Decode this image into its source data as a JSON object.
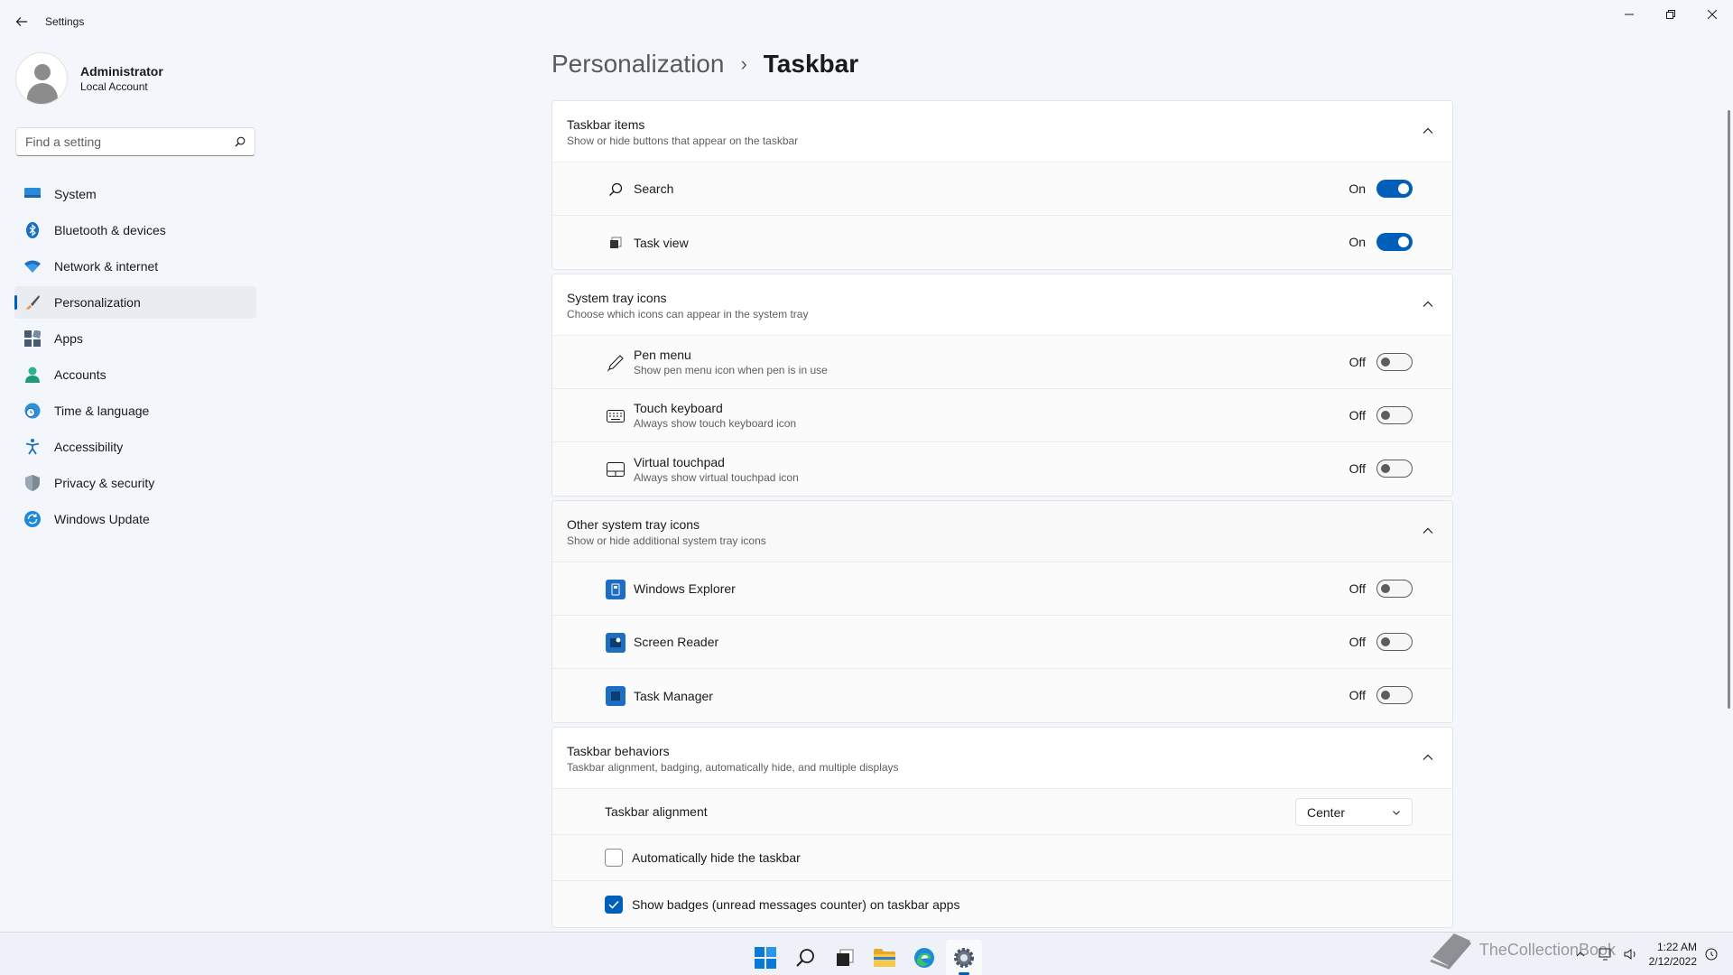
{
  "window": {
    "title": "Settings",
    "controls": [
      "minimize",
      "restore",
      "close"
    ]
  },
  "profile": {
    "name": "Administrator",
    "account_type": "Local Account"
  },
  "search": {
    "placeholder": "Find a setting"
  },
  "nav": [
    {
      "label": "System",
      "icon": "monitor-icon",
      "selected": false
    },
    {
      "label": "Bluetooth & devices",
      "icon": "bluetooth-icon",
      "selected": false
    },
    {
      "label": "Network & internet",
      "icon": "wifi-icon",
      "selected": false
    },
    {
      "label": "Personalization",
      "icon": "brush-icon",
      "selected": true
    },
    {
      "label": "Apps",
      "icon": "apps-icon",
      "selected": false
    },
    {
      "label": "Accounts",
      "icon": "person-icon",
      "selected": false
    },
    {
      "label": "Time & language",
      "icon": "globe-clock-icon",
      "selected": false
    },
    {
      "label": "Accessibility",
      "icon": "accessibility-icon",
      "selected": false
    },
    {
      "label": "Privacy & security",
      "icon": "shield-icon",
      "selected": false
    },
    {
      "label": "Windows Update",
      "icon": "update-icon",
      "selected": false
    }
  ],
  "breadcrumb": {
    "parent": "Personalization",
    "separator": "›",
    "current": "Taskbar"
  },
  "groups": {
    "taskbar_items": {
      "title": "Taskbar items",
      "description": "Show or hide buttons that appear on the taskbar",
      "rows": [
        {
          "label": "Search",
          "state": "On",
          "on": true,
          "icon": "search-icon"
        },
        {
          "label": "Task view",
          "state": "On",
          "on": true,
          "icon": "task-view-icon"
        }
      ]
    },
    "system_tray": {
      "title": "System tray icons",
      "description": "Choose which icons can appear in the system tray",
      "rows": [
        {
          "label": "Pen menu",
          "sub": "Show pen menu icon when pen is in use",
          "state": "Off",
          "on": false,
          "icon": "pen-icon"
        },
        {
          "label": "Touch keyboard",
          "sub": "Always show touch keyboard icon",
          "state": "Off",
          "on": false,
          "icon": "keyboard-icon"
        },
        {
          "label": "Virtual touchpad",
          "sub": "Always show virtual touchpad icon",
          "state": "Off",
          "on": false,
          "icon": "touchpad-icon"
        }
      ]
    },
    "other_tray": {
      "title": "Other system tray icons",
      "description": "Show or hide additional system tray icons",
      "rows": [
        {
          "label": "Windows Explorer",
          "state": "Off",
          "on": false,
          "icon": "explorer-icon"
        },
        {
          "label": "Screen Reader",
          "state": "Off",
          "on": false,
          "icon": "screen-reader-icon"
        },
        {
          "label": "Task Manager",
          "state": "Off",
          "on": false,
          "icon": "task-manager-icon"
        }
      ]
    },
    "behaviors": {
      "title": "Taskbar behaviors",
      "description": "Taskbar alignment, badging, automatically hide, and multiple displays",
      "alignment_label": "Taskbar alignment",
      "alignment_value": "Center",
      "autohide_label": "Automatically hide the taskbar",
      "autohide_checked": false,
      "badges_label": "Show badges (unread messages counter) on taskbar apps",
      "badges_checked": true
    }
  },
  "taskbar": {
    "apps": [
      "start-icon",
      "search-icon",
      "task-view-icon",
      "file-explorer-icon",
      "edge-icon",
      "settings-icon"
    ],
    "active_app": "settings-icon",
    "clock_time": "1:22 AM",
    "clock_date": "2/12/2022"
  },
  "watermark": {
    "text": "TheCollectionBook"
  },
  "colors": {
    "accent": "#005fb8",
    "window_bg": "#f3f6fb",
    "card_bg": "#ffffff"
  }
}
